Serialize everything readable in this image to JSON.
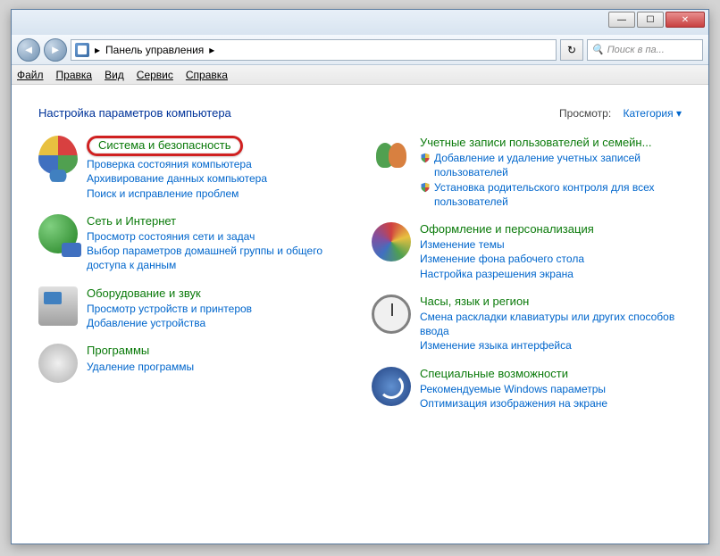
{
  "window": {
    "min": "—",
    "max": "☐",
    "close": "✕"
  },
  "nav": {
    "back": "◄",
    "forward": "►",
    "breadcrumb_root": "Панель управления",
    "breadcrumb_sep": "▸",
    "refresh": "↻",
    "search_icon": "🔍",
    "search_placeholder": "Поиск в па..."
  },
  "menu": {
    "file": "Файл",
    "edit": "Правка",
    "view": "Вид",
    "tools": "Сервис",
    "help": "Справка"
  },
  "header": {
    "title": "Настройка параметров компьютера",
    "view_label": "Просмотр:",
    "view_value": "Категория",
    "dropdown": "▾"
  },
  "left": [
    {
      "title": "Система и безопасность",
      "highlighted": true,
      "links": [
        {
          "text": "Проверка состояния компьютера"
        },
        {
          "text": "Архивирование данных компьютера"
        },
        {
          "text": "Поиск и исправление проблем"
        }
      ]
    },
    {
      "title": "Сеть и Интернет",
      "links": [
        {
          "text": "Просмотр состояния сети и задач"
        },
        {
          "text": "Выбор параметров домашней группы и общего доступа к данным"
        }
      ]
    },
    {
      "title": "Оборудование и звук",
      "links": [
        {
          "text": "Просмотр устройств и принтеров"
        },
        {
          "text": "Добавление устройства"
        }
      ]
    },
    {
      "title": "Программы",
      "links": [
        {
          "text": "Удаление программы"
        }
      ]
    }
  ],
  "right": [
    {
      "title": "Учетные записи пользователей и семейн...",
      "links": [
        {
          "text": "Добавление и удаление учетных записей пользователей",
          "shield": true
        },
        {
          "text": "Установка родительского контроля для всех пользователей",
          "shield": true
        }
      ]
    },
    {
      "title": "Оформление и персонализация",
      "links": [
        {
          "text": "Изменение темы"
        },
        {
          "text": "Изменение фона рабочего стола"
        },
        {
          "text": "Настройка разрешения экрана"
        }
      ]
    },
    {
      "title": "Часы, язык и регион",
      "links": [
        {
          "text": "Смена раскладки клавиатуры или других способов ввода"
        },
        {
          "text": "Изменение языка интерфейса"
        }
      ]
    },
    {
      "title": "Специальные возможности",
      "links": [
        {
          "text": "Рекомендуемые Windows параметры"
        },
        {
          "text": "Оптимизация изображения на экране"
        }
      ]
    }
  ]
}
